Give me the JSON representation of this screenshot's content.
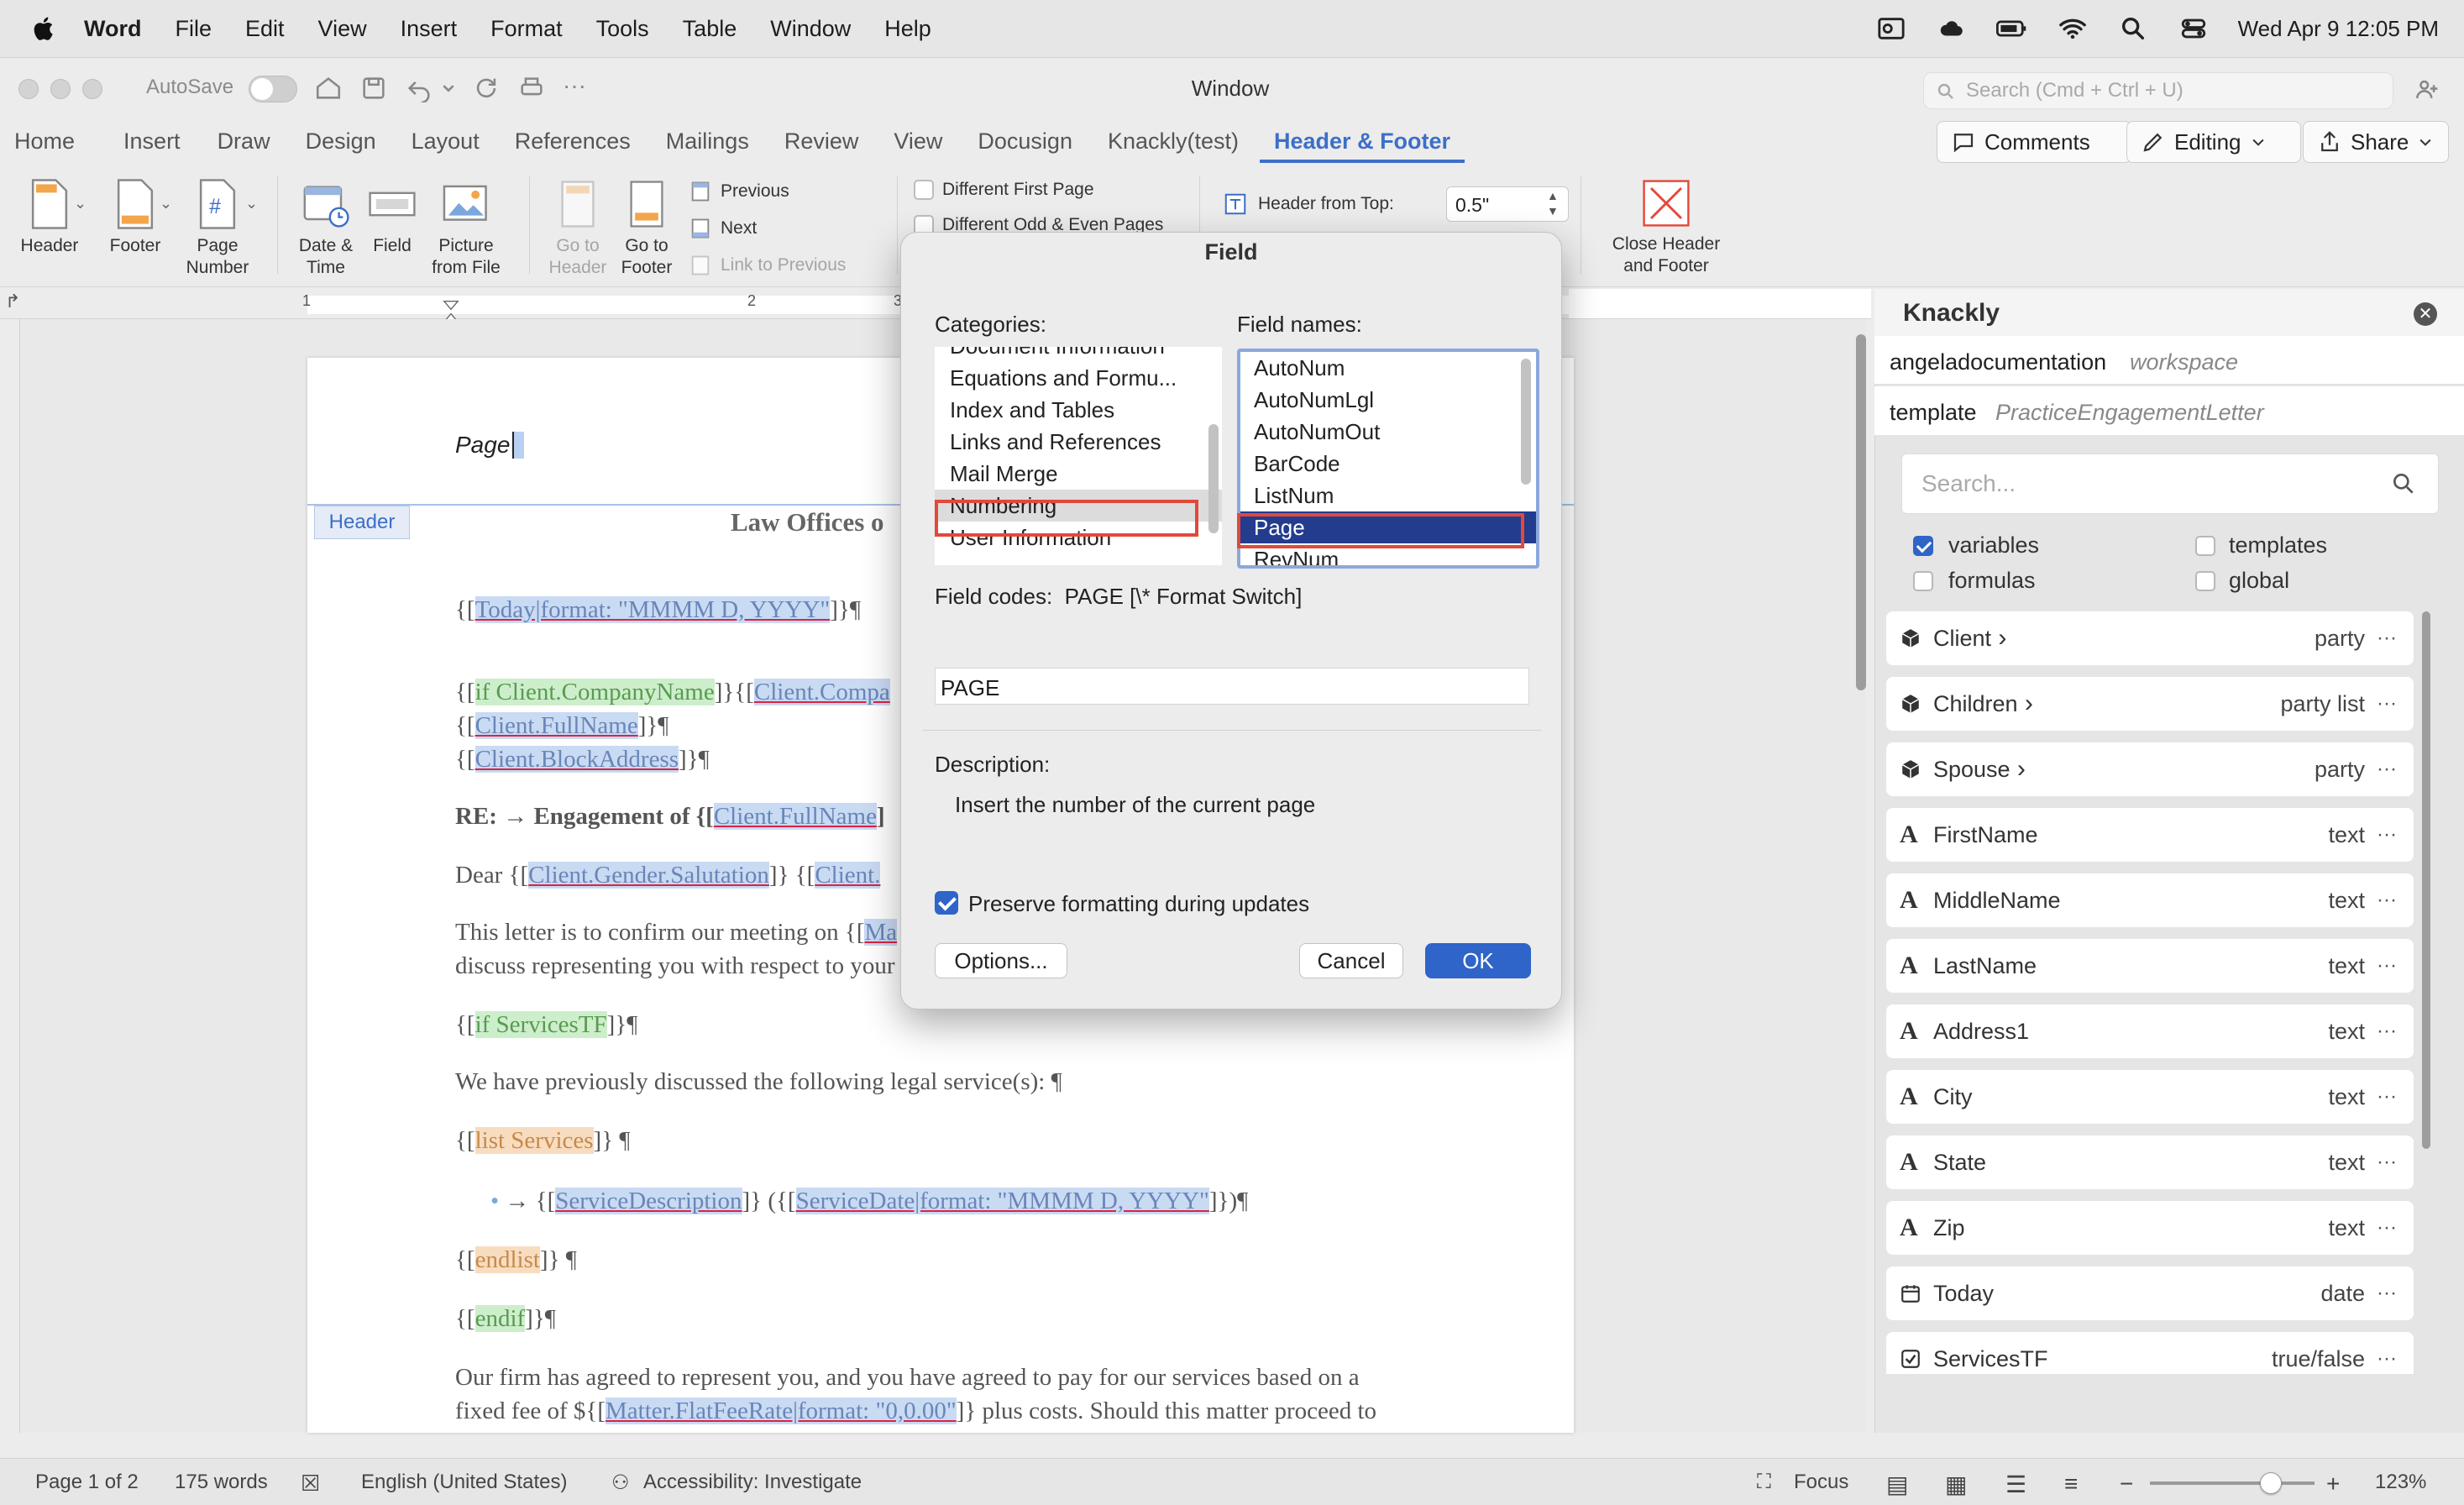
{
  "menubar": {
    "app": "Word",
    "items": [
      "File",
      "Edit",
      "View",
      "Insert",
      "Format",
      "Tools",
      "Table",
      "Window",
      "Help"
    ],
    "clock": "Wed Apr 9  12:05 PM"
  },
  "titlebar": {
    "autosave": "AutoSave",
    "title": "Window",
    "search_placeholder": "Search (Cmd + Ctrl + U)"
  },
  "tabs": [
    "Home",
    "Insert",
    "Draw",
    "Design",
    "Layout",
    "References",
    "Mailings",
    "Review",
    "View",
    "Docusign",
    "Knackly(test)",
    "Header & Footer"
  ],
  "top_buttons": {
    "comments": "Comments",
    "editing": "Editing",
    "share": "Share"
  },
  "ribbon": {
    "header": "Header",
    "footer": "Footer",
    "page_number": [
      "Page",
      "Number"
    ],
    "date_time": [
      "Date &",
      "Time"
    ],
    "field": "Field",
    "picture": [
      "Picture",
      "from File"
    ],
    "goto_header": [
      "Go to",
      "Header"
    ],
    "goto_footer": [
      "Go to",
      "Footer"
    ],
    "previous": "Previous",
    "next": "Next",
    "link_previous": "Link to Previous",
    "diff_first": "Different First Page",
    "diff_oddeven": "Different Odd & Even Pages",
    "header_from_top": "Header from Top:",
    "header_from_top_value": "0.5\"",
    "close": [
      "Close Header",
      "and Footer"
    ]
  },
  "ruler": {
    "marks": [
      "1",
      "2",
      "3"
    ]
  },
  "document": {
    "page_field": "Page",
    "header_tag": "Header",
    "law_offices": "Law Offices o",
    "today": "Today|format: \"MMMM D, YYYY\"",
    "if_company": "if Client.CompanyName",
    "client_compa": "Client.Compa",
    "client_fullname": "Client.FullName",
    "client_block": "Client.BlockAddress",
    "re_text": "RE: → Engagement of {[",
    "dear": "Dear {[",
    "salutation": "Client.Gender.Salutation",
    "client_short": "Client.",
    "letter_l1": "This letter is to confirm our meeting on {[",
    "letter_l1_hl": "Ma",
    "letter_l2": "discuss representing you with respect to your",
    "if_services": "if ServicesTF",
    "prev_discussed": "We have previously discussed the following legal service(s): ¶",
    "list_services": "list Services",
    "service_desc": "ServiceDescription",
    "service_date": "ServiceDate|format: \"MMMM D, YYYY\"",
    "endlist": "endlist",
    "endif": "endif",
    "firm_l1": "Our firm has agreed to represent you, and you have agreed to pay for our services based on a",
    "firm_l2a": "fixed fee of ${[",
    "flat_fee": "Matter.FlatFeeRate|format: \"0,0.00\"",
    "firm_l2b": "]} plus costs.  Should this matter proceed to"
  },
  "dialog": {
    "title": "Field",
    "categories_label": "Categories:",
    "categories": [
      "Document Information",
      "Equations and Formu...",
      "Index and Tables",
      "Links and References",
      "Mail Merge",
      "Numbering",
      "User Information"
    ],
    "selected_category": "Numbering",
    "field_names_label": "Field names:",
    "field_names": [
      "AutoNum",
      "AutoNumLgl",
      "AutoNumOut",
      "BarCode",
      "ListNum",
      "Page",
      "RevNum"
    ],
    "selected_field": "Page",
    "field_codes_label": "Field codes:",
    "field_codes_value": "PAGE [\\* Format Switch]",
    "code_input": "PAGE",
    "description_label": "Description:",
    "description": "Insert the number of the current page",
    "preserve": "Preserve formatting during updates",
    "options": "Options...",
    "cancel": "Cancel",
    "ok": "OK"
  },
  "knackly": {
    "title": "Knackly",
    "workspace_name": "angeladocumentation",
    "workspace_label": "workspace",
    "template_label": "template",
    "template_name": "PracticeEngagementLetter",
    "search_placeholder": "Search...",
    "filters": [
      {
        "label": "variables",
        "checked": true
      },
      {
        "label": "templates",
        "checked": false
      },
      {
        "label": "formulas",
        "checked": false
      },
      {
        "label": "global",
        "checked": false
      }
    ],
    "items": [
      {
        "name": "Client",
        "type": "party",
        "icon": "cube-icon",
        "chevron": true
      },
      {
        "name": "Children",
        "type": "party list",
        "icon": "cube-icon",
        "chevron": true
      },
      {
        "name": "Spouse",
        "type": "party",
        "icon": "cube-icon",
        "chevron": true
      },
      {
        "name": "FirstName",
        "type": "text",
        "icon": "text-icon",
        "chevron": false
      },
      {
        "name": "MiddleName",
        "type": "text",
        "icon": "text-icon",
        "chevron": false
      },
      {
        "name": "LastName",
        "type": "text",
        "icon": "text-icon",
        "chevron": false
      },
      {
        "name": "Address1",
        "type": "text",
        "icon": "text-icon",
        "chevron": false
      },
      {
        "name": "City",
        "type": "text",
        "icon": "text-icon",
        "chevron": false
      },
      {
        "name": "State",
        "type": "text",
        "icon": "text-icon",
        "chevron": false
      },
      {
        "name": "Zip",
        "type": "text",
        "icon": "text-icon",
        "chevron": false
      },
      {
        "name": "Today",
        "type": "date",
        "icon": "calendar-icon",
        "chevron": false
      },
      {
        "name": "ServicesTF",
        "type": "true/false",
        "icon": "checkbox-icon",
        "chevron": false
      }
    ]
  },
  "statusbar": {
    "page": "Page 1 of 2",
    "words": "175 words",
    "language": "English (United States)",
    "accessibility": "Accessibility: Investigate",
    "focus": "Focus",
    "zoom": "123%"
  },
  "colors": {
    "accent": "#3c6fc8",
    "selection": "#233c8e",
    "highlight_box": "#e3483a"
  }
}
